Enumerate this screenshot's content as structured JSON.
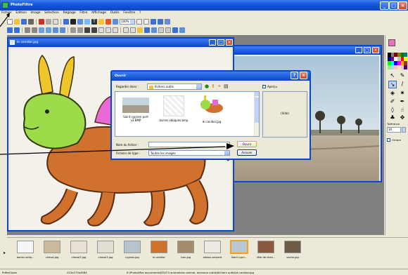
{
  "app": {
    "title": "PhotoFiltre"
  },
  "menu": [
    "Fichier",
    "Edition",
    "Image",
    "Sélection",
    "Réglage",
    "Filtre",
    "Affichage",
    "Outils",
    "Fenêtre",
    "?"
  ],
  "toolbar": {
    "zoom": "100%"
  },
  "doc1": {
    "title": "le canidor.jpg"
  },
  "dialog": {
    "title": "Ouvrir",
    "look_in_label": "Regarder dans :",
    "look_in_value": "fichiers outils",
    "preview_checkbox_label": "Aperçu",
    "preview_text": "(Vide)",
    "files": [
      {
        "name": "Saint cyprien port v2.BMP"
      },
      {
        "name": "barres obliques.bmp"
      },
      {
        "name": "le canidor.jpg"
      }
    ],
    "filename_label": "Nom du fichier :",
    "filename_value": "",
    "filetype_label": "Fichiers de type :",
    "filetype_value": "Toutes les images",
    "open_button": "Ouvrir",
    "cancel_button": "Annuler"
  },
  "palette": {
    "tolerance_label": "Tolérance",
    "tolerance_value": "30",
    "shadow_label": "Ombre"
  },
  "thumbnails": [
    {
      "label": "barres obliq..."
    },
    {
      "label": "cheval.jpg"
    },
    {
      "label": "cheval2.jpg"
    },
    {
      "label": "cheval3.jpg"
    },
    {
      "label": "cygnes.jpg"
    },
    {
      "label": "le canidor"
    },
    {
      "label": "Lion.jpg"
    },
    {
      "label": "oiseau-serpent"
    },
    {
      "label": "Saint cypri..."
    },
    {
      "label": "tête de chev..."
    },
    {
      "label": "vache.jpg"
    }
  ],
  "status": {
    "left": "Prête/Open",
    "mid": "223x175x4584",
    "path": "E:\\Photo\\Mes documents\\DSCF4 animations animal, animaux outils\\fichiers outils\\le canidor.jpg"
  },
  "colors": {
    "title_blue": "#0a46c8",
    "accent_orange": "#f7a11a"
  }
}
